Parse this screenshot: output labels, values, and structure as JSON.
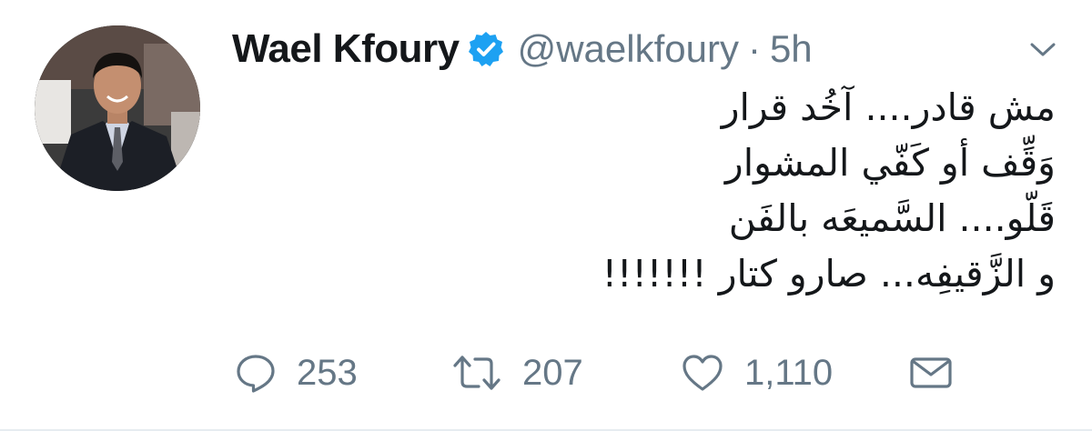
{
  "tweet": {
    "author": {
      "display_name": "Wael Kfoury",
      "handle": "@waelkfoury",
      "verified": true
    },
    "separator": "·",
    "time": "5h",
    "text_lines": [
      "مش قادر.... آخُد قرار",
      "وَقِّف أو كَفّي المشوار",
      "قَلّو.... السَّميعَه بالفَن",
      "و الزَّقيفِه... صارو كتار !!!!!!!"
    ],
    "actions": {
      "reply_count": "253",
      "retweet_count": "207",
      "like_count": "1,110"
    }
  },
  "colors": {
    "text": "#14171a",
    "secondary": "#657786",
    "verified_blue": "#1da1f2",
    "divider": "#e6ecf0"
  },
  "icons": [
    "chevron-down-icon",
    "verified-badge-icon",
    "reply-icon",
    "retweet-icon",
    "like-icon",
    "direct-message-icon"
  ]
}
